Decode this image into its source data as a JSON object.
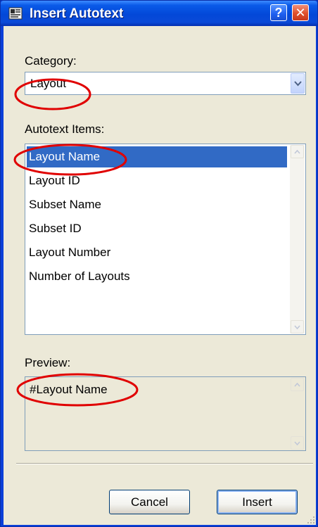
{
  "window": {
    "title": "Insert Autotext",
    "help_glyph": "?",
    "close_glyph": "✕"
  },
  "category": {
    "label": "Category:",
    "selected": "Layout"
  },
  "items": {
    "label": "Autotext Items:",
    "list": [
      {
        "label": "Layout Name",
        "selected": true
      },
      {
        "label": "Layout ID",
        "selected": false
      },
      {
        "label": "Subset Name",
        "selected": false
      },
      {
        "label": "Subset ID",
        "selected": false
      },
      {
        "label": "Layout Number",
        "selected": false
      },
      {
        "label": "Number of Layouts",
        "selected": false
      }
    ]
  },
  "preview": {
    "label": "Preview:",
    "text": "#Layout Name"
  },
  "buttons": {
    "cancel": "Cancel",
    "insert": "Insert"
  },
  "colors": {
    "selection": "#316ac5",
    "annotation": "#e00000",
    "dialog_bg": "#ece9d8",
    "titlebar": "#0a4ad8"
  },
  "icons": [
    "app-icon",
    "help-icon",
    "close-icon",
    "chevron-down-icon",
    "scroll-up-icon",
    "scroll-down-icon",
    "resize-grip-icon"
  ]
}
